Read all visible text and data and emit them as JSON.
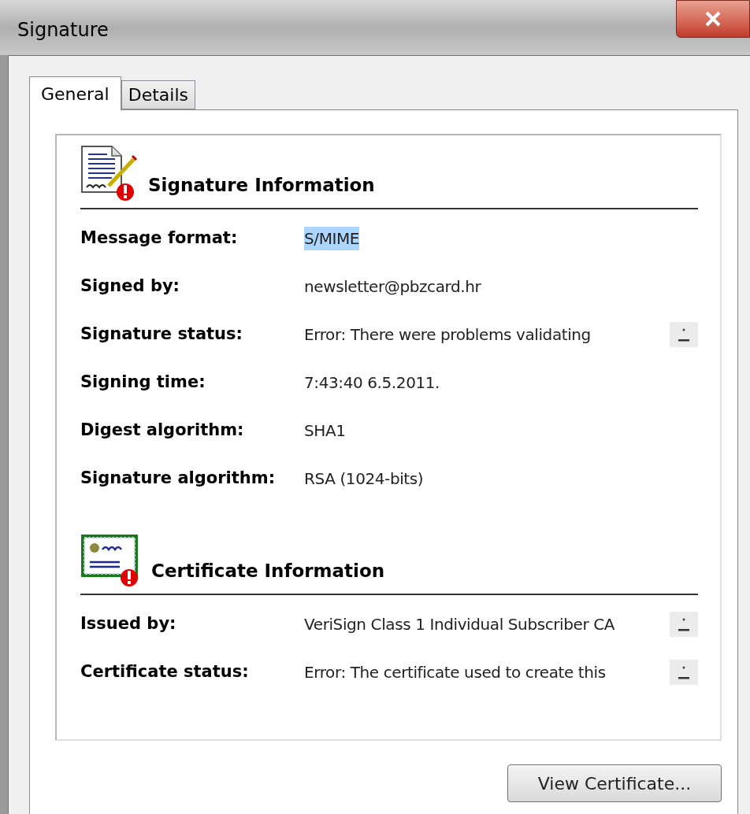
{
  "window": {
    "title": "Signature"
  },
  "tabs": [
    {
      "label": "General",
      "selected": true
    },
    {
      "label": "Details",
      "selected": false
    }
  ],
  "sections": [
    {
      "kind": "signature",
      "heading": "Signature Information",
      "warning": true,
      "rows": [
        {
          "label": "Message format:",
          "value": "S/MIME",
          "highlighted": true,
          "kind": "plain"
        },
        {
          "label": "Signed by:",
          "value": "newsletter@pbzcard.hr",
          "highlighted": false,
          "kind": "plain"
        },
        {
          "label": "Signature status:",
          "value": "Error: There were problems validating",
          "highlighted": false,
          "kind": "expandable"
        },
        {
          "label": "Signing time:",
          "value": "7:43:40 6.5.2011.",
          "highlighted": false,
          "kind": "plain"
        },
        {
          "label": "Digest algorithm:",
          "value": "SHA1",
          "highlighted": false,
          "kind": "plain"
        },
        {
          "label": "Signature algorithm:",
          "value": "RSA (1024-bits)",
          "highlighted": false,
          "kind": "plain"
        }
      ]
    },
    {
      "kind": "certificate",
      "heading": "Certificate Information",
      "warning": true,
      "rows": [
        {
          "label": "Issued by:",
          "value": "VeriSign Class 1 Individual Subscriber CA",
          "highlighted": false,
          "kind": "expandable"
        },
        {
          "label": "Certificate status:",
          "value": "Error: The certificate used to create this",
          "highlighted": false,
          "kind": "expandable"
        }
      ]
    }
  ],
  "buttons": [
    {
      "label": "View Certificate..."
    }
  ]
}
